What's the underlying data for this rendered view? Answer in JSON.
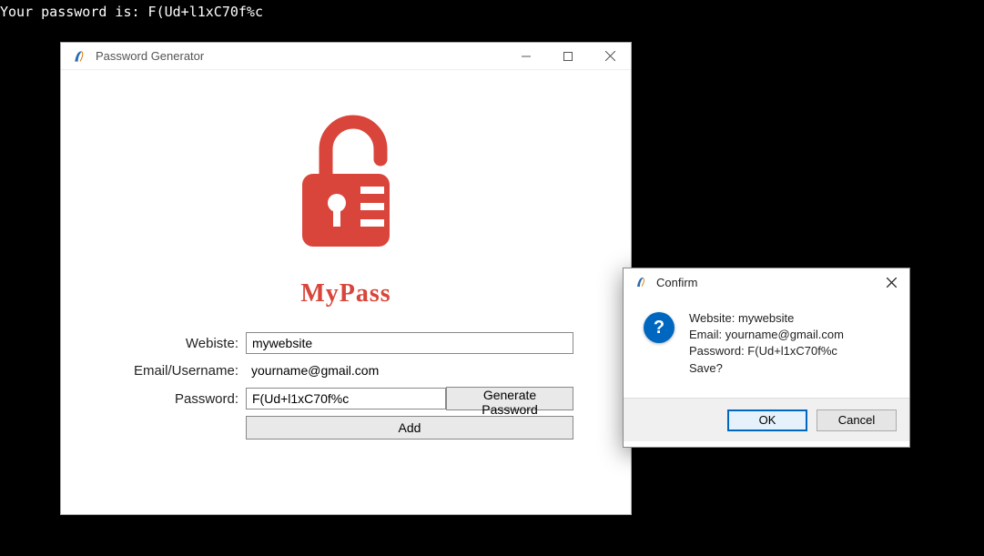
{
  "console": {
    "line": "Your password is: F(Ud+l1xC70f%c"
  },
  "window": {
    "title": "Password Generator",
    "logo_text": "MyPass"
  },
  "form": {
    "website_label": "Webiste:",
    "website_value": "mywebsite",
    "email_label": "Email/Username:",
    "email_value": "yourname@gmail.com",
    "password_label": "Password:",
    "password_value": "F(Ud+l1xC70f%c",
    "generate_btn": "Generate Password",
    "add_btn": "Add"
  },
  "dialog": {
    "title": "Confirm",
    "line1": "Website: mywebsite",
    "line2": "Email: yourname@gmail.com",
    "line3": "Password: F(Ud+l1xC70f%c",
    "line4": "Save?",
    "ok": "OK",
    "cancel": "Cancel"
  }
}
